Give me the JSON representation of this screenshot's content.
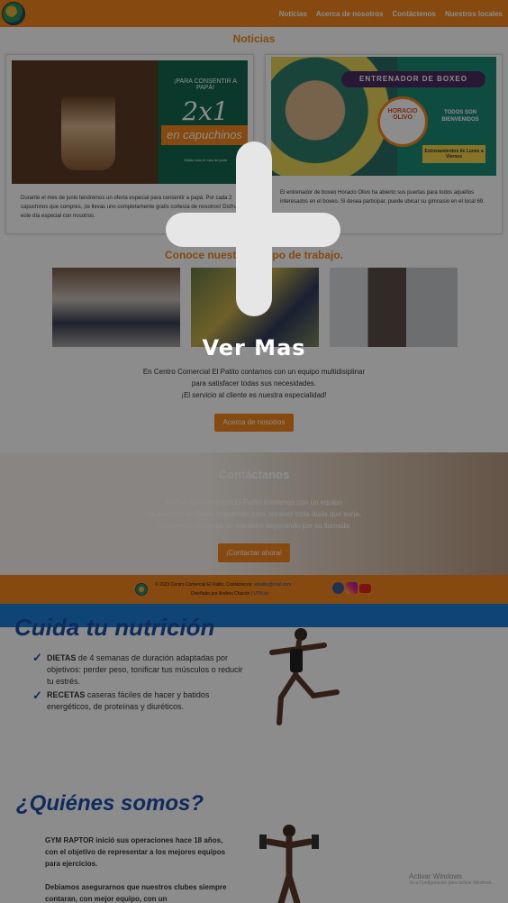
{
  "nav": {
    "items": [
      "Noticias",
      "Acerca de nosotros",
      "Contáctenos",
      "Nuestros locales"
    ]
  },
  "news": {
    "heading": "Noticias",
    "card1": {
      "img_line1": "¡PARA CONSENTIR A PAPÁ!",
      "img_big": "2x1",
      "img_band": "en capuchinos",
      "img_small": "Válido todo el mes de junio",
      "text": "Durante el mes de junio tendremos un oferta especial para consentir a papá. Por cada 2 capuchinos que compres, ¡te llevas uno completamente gratis cortesía de nosotros! Disfruta este día especial con nosotros."
    },
    "card2": {
      "img_title": "ENTRENADOR DE BOXEO",
      "img_badge": "HORACIO OLIVO",
      "img_todos": "TODOS SON BIENVENIDOS",
      "img_sched": "Entrenamientos de Lunes a Viernes",
      "text": "El entrenador de boxeo Horacio Olivo ha abierto sus puertas para todos aquellos interesados en el boxeo. Si desea participar, puede ubicar su gimnasio en el local 69."
    }
  },
  "team": {
    "heading": "Conoce nuestro equipo de trabajo.",
    "line1": "En Centro Comercial El Patito contamos con un equipo multidisiplinar",
    "line2": "para satisfacer todas sus necesidades.",
    "line3": "¡El servicio al cliente es nuestra especialidad!",
    "button": "Acerca de nosotros"
  },
  "contact": {
    "heading": "Contáctanos",
    "line1": "En Centro Comercial El Patito contamos con un equipo",
    "line2": "de atención al cliente preparado para resolver toda duda que surja.",
    "line3": "¡Llámenos! Tenemos un operador esperando por su llamada.",
    "button": "¡Contactar ahora!"
  },
  "footer": {
    "line1": "© 2023 Centro Comercial El Patito. Contáctenos: ",
    "email": "elpatito@mail.com",
    "line2": "Diseñado por Andrés Chacón | ",
    "credit": "UTN.ac"
  },
  "gym": {
    "nutrition_title": "Cuida tu nutrición",
    "bullet1_bold": "DIETAS",
    "bullet1": " de 4 semanas de duración adaptadas por objetivos: perder peso, tonificar tus músculos o reducir tu estrés.",
    "bullet2_bold": "RECETAS",
    "bullet2": " caseras fáciles de hacer y batidos energéticos, de proteínas y diuréticos.",
    "who_title": "¿Quiénes somos?",
    "para1": "GYM RAPTOR inició sus operaciones hace 18 años, con el objetivo de representar a los mejores equipos para ejercicios.",
    "para2": "Debiamos asegurarnos que nuestros clubes siempre contaran, con mejor equipo, con un"
  },
  "watermark": {
    "line1": "Activar Windows",
    "line2": "Ve a Configuración para activar Windows."
  },
  "overlay": {
    "label": "Ver Mas"
  },
  "colors": {
    "accent": "#f4851d",
    "gym_blue": "#1b4fa8"
  }
}
